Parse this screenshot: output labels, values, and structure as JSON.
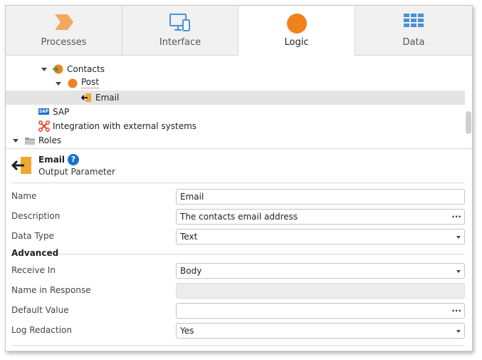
{
  "tabs": [
    {
      "label": "Processes",
      "icon": "processes-chevron-icon",
      "color": "#f4a85b"
    },
    {
      "label": "Interface",
      "icon": "interface-devices-icon",
      "color": "#4a90d9"
    },
    {
      "label": "Logic",
      "icon": "logic-circle-icon",
      "color": "#f0821e",
      "active": true
    },
    {
      "label": "Data",
      "icon": "data-table-icon",
      "color": "#4a90d9"
    }
  ],
  "tree": {
    "contacts": "Contacts",
    "post": "Post",
    "email": "Email",
    "sap": "SAP",
    "sap_logo": "SAP",
    "integration": "Integration with external systems",
    "roles": "Roles"
  },
  "header": {
    "title": "Email",
    "help": "?",
    "subtitle": "Output Parameter"
  },
  "properties": {
    "name_label": "Name",
    "name_value": "Email",
    "description_label": "Description",
    "description_value": "The contacts email address",
    "data_type_label": "Data Type",
    "data_type_value": "Text",
    "advanced_label": "Advanced",
    "receive_in_label": "Receive In",
    "receive_in_value": "Body",
    "name_in_response_label": "Name in Response",
    "name_in_response_value": "",
    "default_value_label": "Default Value",
    "default_value_value": "",
    "log_redaction_label": "Log Redaction",
    "log_redaction_value": "Yes",
    "more_button": "..."
  },
  "colors": {
    "accent_orange": "#f0821e",
    "accent_blue": "#4a90d9",
    "help_blue": "#1a73c9",
    "selection": "#e4e4e4"
  }
}
